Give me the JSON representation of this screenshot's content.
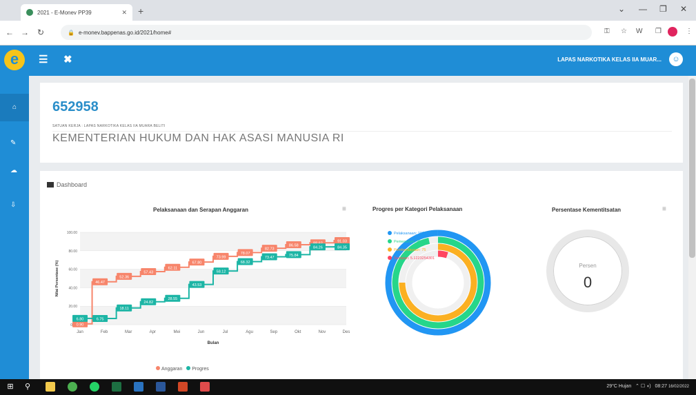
{
  "browser": {
    "tab_title": "2021 - E-Monev PP39",
    "url": "e-monev.bappenas.go.id/2021/home#",
    "new_tab": "+"
  },
  "header": {
    "user_name": "LAPAS NARKOTIKA KELAS IIA MUAR..."
  },
  "profile": {
    "code": "652958",
    "satker": "SATUAN KERJA : LAPAS NARKOTIKA KELAS IIA MUARA BELITI",
    "ministry": "KEMENTERIAN HUKUM DAN HAK ASASI MANUSIA RI"
  },
  "section": {
    "label": "Dashboard"
  },
  "chart_line_title": "Pelaksanaan dan Serapan Anggaran",
  "chart_radial_title": "Progres per Kategori Pelaksanaan",
  "chart_gauge": {
    "title": "Persentase Kementitsatan",
    "label": "Persen",
    "value": "0"
  },
  "chart_data": [
    {
      "type": "line",
      "title": "Pelaksanaan dan Serapan Anggaran",
      "xlabel": "Bulan",
      "ylabel": "Nilai Persentase (%)",
      "ylim": [
        0,
        100
      ],
      "y_ticks": [
        "0.00",
        "20.00",
        "40.00",
        "60.00",
        "80.00",
        "100.00"
      ],
      "categories": [
        "Jan",
        "Feb",
        "Mar",
        "Apr",
        "Mei",
        "Jun",
        "Jul",
        "Agu",
        "Sep",
        "Okt",
        "Nov",
        "Des"
      ],
      "series": [
        {
          "name": "Anggaran",
          "color": "#f7856b",
          "values": [
            0.9,
            46.47,
            52.36,
            57.43,
            62.11,
            67.8,
            73.99,
            78.07,
            82.73,
            86.58,
            88.62,
            91.03
          ]
        },
        {
          "name": "Progres",
          "color": "#1cb5a5",
          "values": [
            6.8,
            6.75,
            18.11,
            24.82,
            28.55,
            43.53,
            58.12,
            68.32,
            73.47,
            75.84,
            84.26,
            84.35
          ]
        }
      ],
      "data_labels": {
        "Anggaran": [
          "0.90",
          "46.47",
          "52.36",
          "57.43",
          "62.11",
          "67.80",
          "73.99",
          "78.07",
          "82.73",
          "86.58",
          "88.62",
          "91.03"
        ],
        "Progres": [
          "6.80",
          "6.75",
          "18.11",
          "24.82",
          "28.55",
          "43.53",
          "58.12",
          "68.32",
          "73.47",
          "75.84",
          "84.26",
          "84.35"
        ]
      },
      "legend": "bottom"
    },
    {
      "type": "radial_bar",
      "title": "Progres per Kategori Pelaksanaan",
      "series": [
        {
          "name": "Pelaksanaan",
          "label": "Pelaksanaan: 100",
          "color": "#2196f3",
          "value": 100
        },
        {
          "name": "Pemenuhan",
          "label": "Pemenuhan: 96.67",
          "color": "#26d68a",
          "value": 96.67
        },
        {
          "name": "Pemberdayaan",
          "label": "Pemberdayaan: 75",
          "color": "#fbb022",
          "value": 75
        },
        {
          "name": "Serapan",
          "label": "Serapan: 5.1223254301",
          "color": "#ff4560",
          "value": 5.12
        }
      ]
    }
  ],
  "taskbar": {
    "weather": "29°C Hujan",
    "time": "08:27",
    "date": "16/02/2022"
  }
}
